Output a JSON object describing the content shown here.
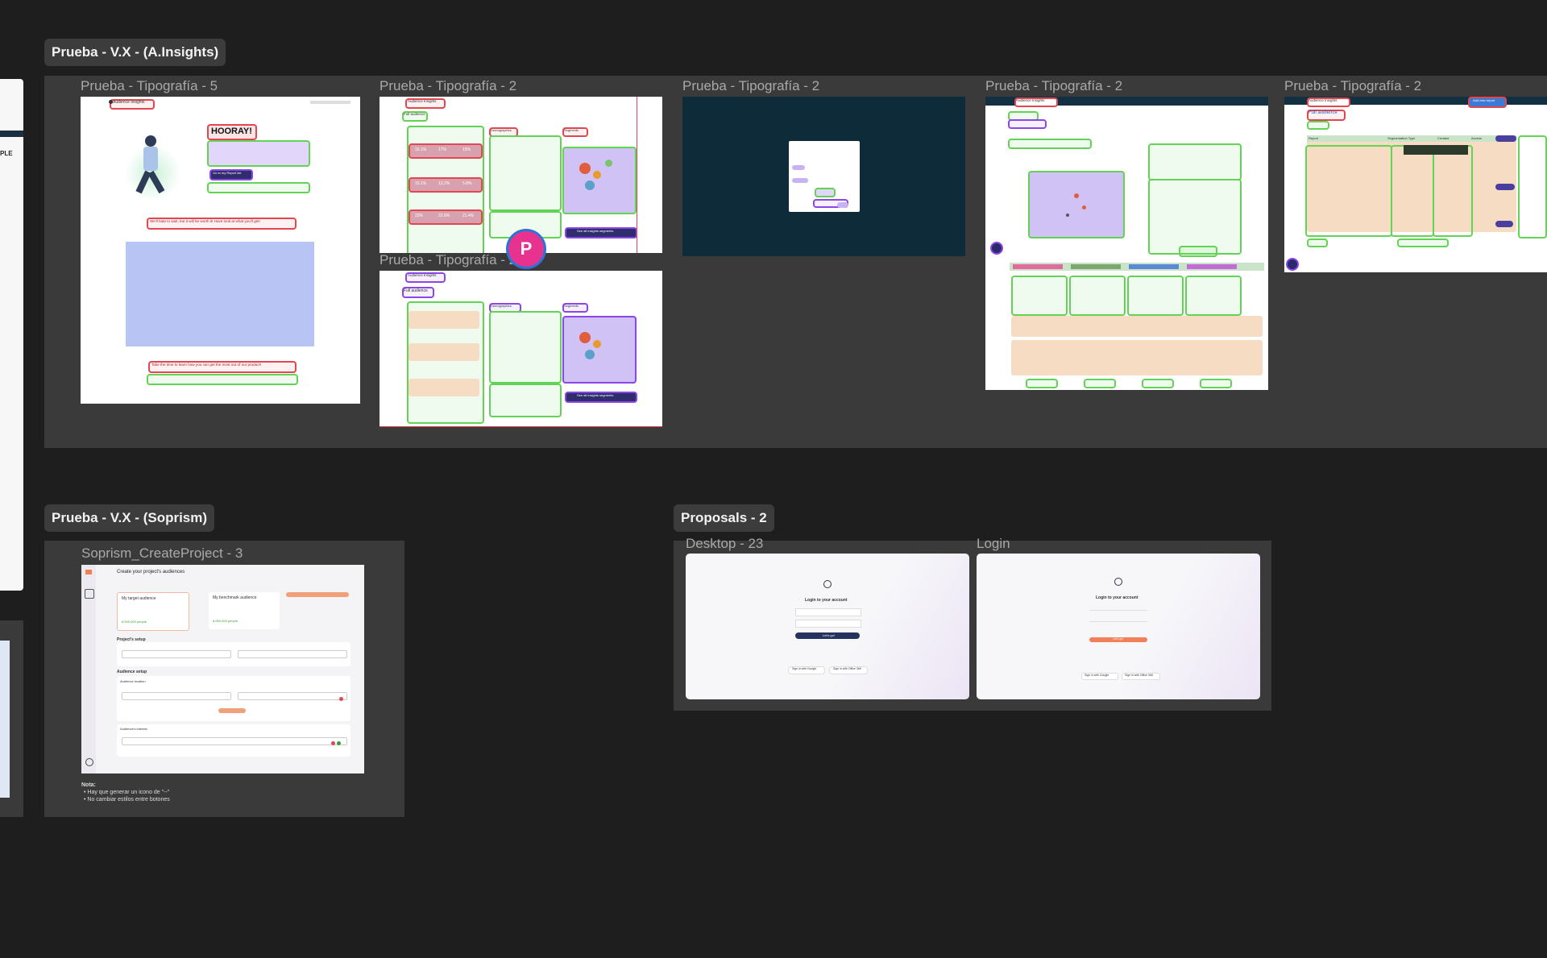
{
  "sections": [
    {
      "id": "ainsights",
      "label": "Prueba - V.X - (A.Insights)"
    },
    {
      "id": "soprism",
      "label": "Prueba - V.X - (Soprism)"
    },
    {
      "id": "proposals",
      "label": "Proposals - 2"
    }
  ],
  "frames": {
    "tipo5": "Prueba - Tipografía - 5",
    "tipo2a": "Prueba - Tipografía - 2",
    "tipo2b": "Prueba - Tipografía - 2",
    "tipo2c": "Prueba - Tipografía - 2",
    "tipo2d": "Prueba - Tipografía - 2",
    "tipo2e": "Prueba - Tipografía - 2",
    "soprism": "Soprism_CreateProject - 3",
    "desktop23": "Desktop - 23",
    "login": "Login"
  },
  "cursor": {
    "initial": "P",
    "color": "#e8328f"
  },
  "left_edge_text": "PLE",
  "hooray": {
    "app_name": "Audience Insights",
    "title": "HOORAY!",
    "wait_msg": "We'll hate to wait, but it will be worth it! Have look at what you'll get!",
    "learn_msg": "Take the time to learn how you can get the most out of our product!",
    "go_button": "Go to my Report list"
  },
  "insights": {
    "app_name": "Audience Insights",
    "full_audience": "Full audience",
    "demographics": "Demographics",
    "segments": "Segments",
    "see_all": "See all insights segments",
    "percents_row1": [
      "15.1%",
      "17%",
      "15%"
    ],
    "percents_row2": [
      "15.1%",
      "13.2%",
      "5.8%"
    ],
    "percents_row3": [
      "23%",
      "22.8%",
      "21.4%"
    ]
  },
  "reports": {
    "app_name": "Audience Insights",
    "full_audience": "Full audience",
    "add_report": "Add new report",
    "columns": [
      "Report",
      "Segmentation Type",
      "Created",
      "Access"
    ]
  },
  "soprism": {
    "title": "Create your project's audiences",
    "target": "My target audience",
    "benchmark": "My benchmark audience",
    "target_count": "8,000,000 people",
    "benchmark_count": "8,000,000 people",
    "project_setup": "Project's setup",
    "audience_setup": "Audience setup",
    "audience_location": "Audience location",
    "audience_interest": "Audience's interest",
    "note_title": "Nota:",
    "notes": [
      "Hay que generar un icono de \"--\"",
      "No cambiar estilos entre botones"
    ]
  },
  "login": {
    "title": "Login to your account",
    "button": "Let's go!",
    "google": "Sign in with Google",
    "office": "Sign in with Office 365"
  },
  "colors": {
    "canvas": "#1e1e1e",
    "section": "#3a3a3a",
    "highlight_red": "#e2474f",
    "highlight_green": "#63d356",
    "highlight_purple": "#8b46e8"
  }
}
